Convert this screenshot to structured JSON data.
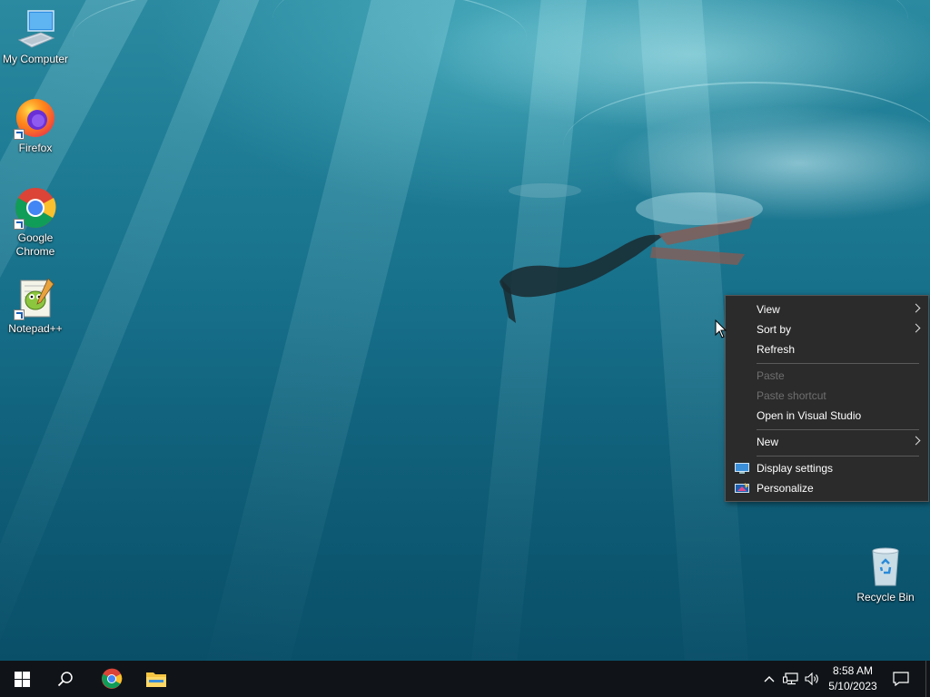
{
  "desktop_icons": [
    {
      "label": "My Computer"
    },
    {
      "label": "Firefox"
    },
    {
      "label": "Google Chrome"
    },
    {
      "label": "Notepad++"
    },
    {
      "label": "Recycle Bin"
    }
  ],
  "context_menu": {
    "items": [
      {
        "label": "View",
        "has_submenu": true,
        "enabled": true
      },
      {
        "label": "Sort by",
        "has_submenu": true,
        "enabled": true
      },
      {
        "label": "Refresh",
        "has_submenu": false,
        "enabled": true
      },
      {
        "label": "Paste",
        "has_submenu": false,
        "enabled": false
      },
      {
        "label": "Paste shortcut",
        "has_submenu": false,
        "enabled": false
      },
      {
        "label": "Open in Visual Studio",
        "has_submenu": false,
        "enabled": true
      },
      {
        "label": "New",
        "has_submenu": true,
        "enabled": true
      },
      {
        "label": "Display settings",
        "has_submenu": false,
        "enabled": true,
        "icon": "display-icon"
      },
      {
        "label": "Personalize",
        "has_submenu": false,
        "enabled": true,
        "icon": "personalize-icon"
      }
    ]
  },
  "taskbar": {
    "pinned": [
      "start-icon",
      "search-icon",
      "chrome-icon",
      "file-explorer-icon"
    ],
    "tray_icons": [
      "chevron-up-icon",
      "network-icon",
      "volume-icon"
    ],
    "clock": {
      "time": "8:58 AM",
      "date": "5/10/2023"
    },
    "notification_icon": "action-center-icon"
  },
  "colors": {
    "menu_bg": "#2b2b2b",
    "taskbar_bg": "#101418",
    "disabled_text": "#6f6f6f"
  }
}
